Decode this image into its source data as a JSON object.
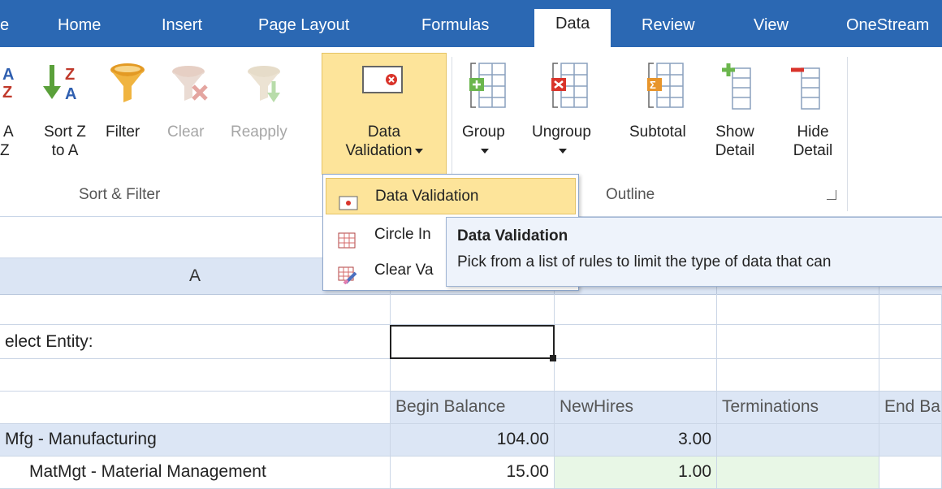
{
  "tabs": [
    {
      "label": "e",
      "active": false
    },
    {
      "label": "Home",
      "active": false
    },
    {
      "label": "Insert",
      "active": false
    },
    {
      "label": "Page Layout",
      "active": false
    },
    {
      "label": "Formulas",
      "active": false
    },
    {
      "label": "Data",
      "active": true
    },
    {
      "label": "Review",
      "active": false
    },
    {
      "label": "View",
      "active": false
    },
    {
      "label": "OneStream",
      "active": false
    }
  ],
  "ribbon": {
    "sort_filter": {
      "sort_az": {
        "line1": "A",
        "line2": "Z"
      },
      "sort_za": {
        "line1": "Sort Z",
        "line2": "to A"
      },
      "filter": "Filter",
      "clear": "Clear",
      "reapply": "Reapply",
      "group_label": "Sort & Filter"
    },
    "data_validation": {
      "line1": "Data",
      "line2": "Validation"
    },
    "outline": {
      "group": "Group",
      "ungroup": "Ungroup",
      "subtotal": "Subtotal",
      "show_detail": {
        "line1": "Show",
        "line2": "Detail"
      },
      "hide_detail": {
        "line1": "Hide",
        "line2": "Detail"
      },
      "group_label": "Outline"
    }
  },
  "dropdown": {
    "items": [
      {
        "label": "Data Validation"
      },
      {
        "label": "Circle In"
      },
      {
        "label": "Clear Va"
      }
    ]
  },
  "tooltip": {
    "title": "Data Validation",
    "description": "Pick from a list of rules to limit the type of data that can"
  },
  "sheet": {
    "column_a_header": "A",
    "rows": {
      "select_entity": "elect Entity:",
      "headers": [
        "Begin Balance",
        "NewHires",
        "Terminations",
        "End Ba"
      ],
      "mfg": {
        "label": "Mfg - Manufacturing",
        "begin": "104.00",
        "newhires": "3.00"
      },
      "matmgt": {
        "label": "MatMgt - Material Management",
        "begin": "15.00",
        "newhires": "1.00"
      }
    }
  },
  "colors": {
    "tab_bar": "#2b68b3",
    "highlight": "#fde49a",
    "header_fill": "#dce6f5",
    "green_fill": "#e8f7e6"
  }
}
